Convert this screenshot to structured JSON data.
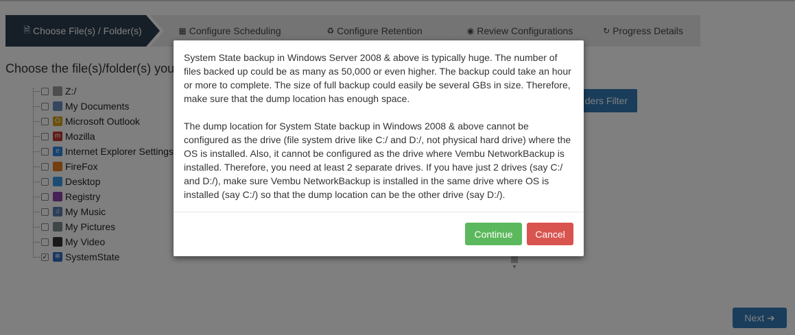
{
  "wizard": {
    "steps": [
      {
        "label": "Choose File(s) / Folder(s)",
        "icon": "file-icon",
        "glyph": "🗎",
        "active": true
      },
      {
        "label": "Configure Scheduling",
        "icon": "calendar-icon",
        "glyph": "▦",
        "active": false
      },
      {
        "label": "Configure Retention",
        "icon": "recycle-icon",
        "glyph": "♻",
        "active": false
      },
      {
        "label": "Review Configurations",
        "icon": "eye-icon",
        "glyph": "◉",
        "active": false
      },
      {
        "label": "Progress Details",
        "icon": "refresh-icon",
        "glyph": "↻",
        "active": false
      }
    ]
  },
  "main": {
    "heading": "Choose the file(s)/folder(s) you",
    "filter_button": "ders Filter",
    "tree": [
      {
        "label": "Z:/",
        "icon": "drive-icon",
        "color": "#9a9a9a",
        "glyph": "",
        "checked": false
      },
      {
        "label": "My Documents",
        "icon": "documents-icon",
        "color": "#6a8fc0",
        "glyph": "",
        "checked": false
      },
      {
        "label": "Microsoft Outlook",
        "icon": "outlook-icon",
        "color": "#d4a017",
        "glyph": "O",
        "checked": false
      },
      {
        "label": "Mozilla",
        "icon": "mozilla-icon",
        "color": "#c0392b",
        "glyph": "m",
        "checked": false
      },
      {
        "label": "Internet Explorer Settings",
        "icon": "ie-icon",
        "color": "#2e86de",
        "glyph": "e",
        "checked": false
      },
      {
        "label": "FireFox",
        "icon": "firefox-icon",
        "color": "#e67e22",
        "glyph": "",
        "checked": false
      },
      {
        "label": "Desktop",
        "icon": "desktop-icon",
        "color": "#3d9be9",
        "glyph": "",
        "checked": false
      },
      {
        "label": "Registry",
        "icon": "registry-icon",
        "color": "#8e44ad",
        "glyph": "",
        "checked": false
      },
      {
        "label": "My Music",
        "icon": "music-icon",
        "color": "#5b7db1",
        "glyph": "♫",
        "checked": false
      },
      {
        "label": "My Pictures",
        "icon": "pictures-icon",
        "color": "#7f8c8d",
        "glyph": "",
        "checked": false
      },
      {
        "label": "My Video",
        "icon": "video-icon",
        "color": "#333333",
        "glyph": "",
        "checked": false
      },
      {
        "label": "SystemState",
        "icon": "systemstate-icon",
        "color": "#2e6fc4",
        "glyph": "✲",
        "checked": true
      }
    ],
    "next_button": "Next ➔"
  },
  "modal": {
    "paragraphs": [
      "System State backup in Windows Server 2008 & above is typically huge. The number of files backed up could be as many as 50,000 or even higher. The backup could take an hour or more to complete. The size of full backup could easily be several GBs in size. Therefore, make sure that the dump location has enough space.",
      "The dump location for System State backup in Windows 2008 & above cannot be configured as the drive (file system drive like C:/ and D:/, not physical hard drive) where the OS is installed. Also, it cannot be configured as the drive where Vembu NetworkBackup is installed. Therefore, you need at least 2 separate drives. If you have just 2 drives (say C:/ and D:/), make sure Vembu NetworkBackup is installed in the same drive where OS is installed (say C:/) so that the dump location can be the other drive (say D:/)."
    ],
    "continue_label": "Continue",
    "cancel_label": "Cancel"
  },
  "colors": {
    "active_step": "#2c3e50",
    "inactive_step": "#e8e8e8",
    "primary": "#337ab7",
    "success": "#5cb85c",
    "danger": "#d9534f"
  }
}
